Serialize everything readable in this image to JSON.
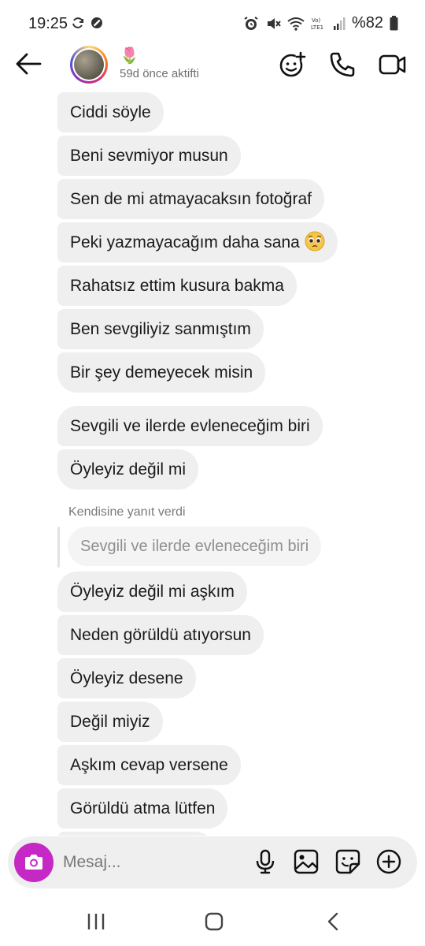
{
  "status_bar": {
    "time": "19:25",
    "battery": "%82",
    "network": "LTE1"
  },
  "header": {
    "name": "🌷",
    "active_status": "59d önce aktifti"
  },
  "messages": [
    {
      "text": "Ciddi söyle"
    },
    {
      "text": "Beni sevmiyor musun"
    },
    {
      "text": "Sen de mi atmayacaksın fotoğraf"
    },
    {
      "text": "Peki yazmayacağım daha sana"
    },
    {
      "text": "Rahatsız ettim kusura bakma"
    },
    {
      "text": "Ben sevgiliyiz sanmıştım"
    },
    {
      "text": "Bir şey demeyecek misin"
    },
    {
      "text": "Sevgili ve ilerde evleneceğim biri"
    },
    {
      "text": "Öyleyiz değil mi"
    },
    {
      "text": "Öyleyiz değil mi aşkım"
    },
    {
      "text": "Neden görüldü atıyorsun"
    },
    {
      "text": "Öyleyiz desene"
    },
    {
      "text": "Değil miyiz"
    },
    {
      "text": "Aşkım cevap versene"
    },
    {
      "text": "Görüldü atma lütfen"
    }
  ],
  "reply": {
    "label": "Kendisine yanıt verdi",
    "quoted_text": "Sevgili ve ilerde evleneceğim biri"
  },
  "composer": {
    "placeholder": "Mesaj..."
  },
  "colors": {
    "bubble": "#efefef",
    "camera_button": "#c628c6",
    "text": "#1a1a1a",
    "secondary_text": "#6f6f6f"
  },
  "icons": {
    "status_left": [
      "sync-icon",
      "do-not-disturb-icon"
    ],
    "status_right": [
      "alarm-icon",
      "mute-icon",
      "wifi-icon",
      "volte-icon",
      "signal-icon",
      "battery-icon"
    ],
    "header": [
      "back-arrow-icon",
      "video-chat-add-icon",
      "phone-icon",
      "video-camera-icon"
    ],
    "composer": [
      "camera-icon",
      "microphone-icon",
      "gallery-icon",
      "sticker-icon",
      "add-icon"
    ],
    "navigation": [
      "recent-apps-icon",
      "home-icon",
      "back-icon"
    ]
  }
}
